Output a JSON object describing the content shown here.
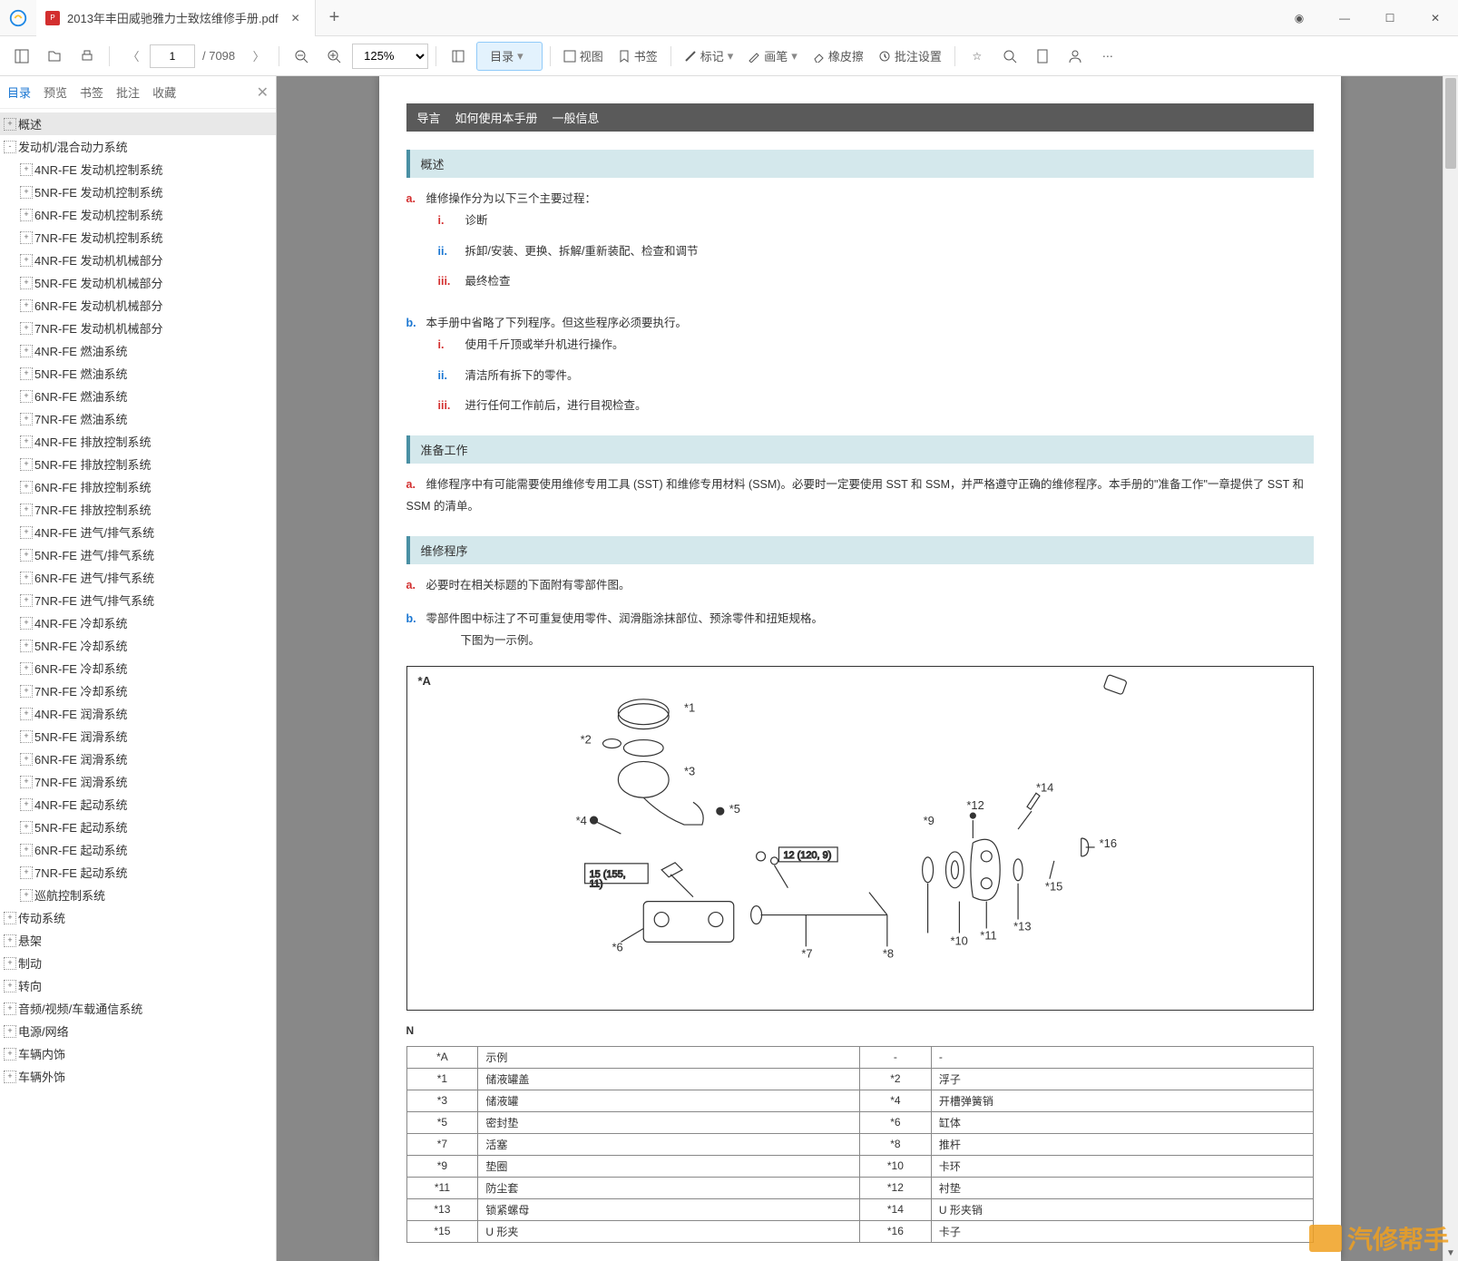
{
  "tab": {
    "title": "2013年丰田威驰雅力士致炫维修手册.pdf",
    "pdf_badge": "P"
  },
  "window": {
    "gear": "⚙"
  },
  "toolbar": {
    "page_current": "1",
    "page_total": "/ 7098",
    "zoom": "125%",
    "toc": "目录",
    "view": "视图",
    "bookmark": "书签",
    "mark": "标记",
    "pen": "画笔",
    "eraser": "橡皮擦",
    "batch": "批注设置"
  },
  "sidebar": {
    "tabs": {
      "toc": "目录",
      "preview": "预览",
      "bookmark": "书签",
      "annot": "批注",
      "fav": "收藏"
    },
    "tree": [
      {
        "lvl": 0,
        "exp": "+",
        "label": "概述",
        "sel": true
      },
      {
        "lvl": 0,
        "exp": "-",
        "label": "发动机/混合动力系统"
      },
      {
        "lvl": 1,
        "exp": "+",
        "label": "4NR-FE 发动机控制系统"
      },
      {
        "lvl": 1,
        "exp": "+",
        "label": "5NR-FE 发动机控制系统"
      },
      {
        "lvl": 1,
        "exp": "+",
        "label": "6NR-FE 发动机控制系统"
      },
      {
        "lvl": 1,
        "exp": "+",
        "label": "7NR-FE 发动机控制系统"
      },
      {
        "lvl": 1,
        "exp": "+",
        "label": "4NR-FE 发动机机械部分"
      },
      {
        "lvl": 1,
        "exp": "+",
        "label": "5NR-FE 发动机机械部分"
      },
      {
        "lvl": 1,
        "exp": "+",
        "label": "6NR-FE 发动机机械部分"
      },
      {
        "lvl": 1,
        "exp": "+",
        "label": "7NR-FE 发动机机械部分"
      },
      {
        "lvl": 1,
        "exp": "+",
        "label": "4NR-FE 燃油系统"
      },
      {
        "lvl": 1,
        "exp": "+",
        "label": "5NR-FE 燃油系统"
      },
      {
        "lvl": 1,
        "exp": "+",
        "label": "6NR-FE 燃油系统"
      },
      {
        "lvl": 1,
        "exp": "+",
        "label": "7NR-FE 燃油系统"
      },
      {
        "lvl": 1,
        "exp": "+",
        "label": "4NR-FE 排放控制系统"
      },
      {
        "lvl": 1,
        "exp": "+",
        "label": "5NR-FE 排放控制系统"
      },
      {
        "lvl": 1,
        "exp": "+",
        "label": "6NR-FE 排放控制系统"
      },
      {
        "lvl": 1,
        "exp": "+",
        "label": "7NR-FE 排放控制系统"
      },
      {
        "lvl": 1,
        "exp": "+",
        "label": "4NR-FE 进气/排气系统"
      },
      {
        "lvl": 1,
        "exp": "+",
        "label": "5NR-FE 进气/排气系统"
      },
      {
        "lvl": 1,
        "exp": "+",
        "label": "6NR-FE 进气/排气系统"
      },
      {
        "lvl": 1,
        "exp": "+",
        "label": "7NR-FE 进气/排气系统"
      },
      {
        "lvl": 1,
        "exp": "+",
        "label": "4NR-FE 冷却系统"
      },
      {
        "lvl": 1,
        "exp": "+",
        "label": "5NR-FE 冷却系统"
      },
      {
        "lvl": 1,
        "exp": "+",
        "label": "6NR-FE 冷却系统"
      },
      {
        "lvl": 1,
        "exp": "+",
        "label": "7NR-FE 冷却系统"
      },
      {
        "lvl": 1,
        "exp": "+",
        "label": "4NR-FE 润滑系统"
      },
      {
        "lvl": 1,
        "exp": "+",
        "label": "5NR-FE 润滑系统"
      },
      {
        "lvl": 1,
        "exp": "+",
        "label": "6NR-FE 润滑系统"
      },
      {
        "lvl": 1,
        "exp": "+",
        "label": "7NR-FE 润滑系统"
      },
      {
        "lvl": 1,
        "exp": "+",
        "label": "4NR-FE 起动系统"
      },
      {
        "lvl": 1,
        "exp": "+",
        "label": "5NR-FE 起动系统"
      },
      {
        "lvl": 1,
        "exp": "+",
        "label": "6NR-FE 起动系统"
      },
      {
        "lvl": 1,
        "exp": "+",
        "label": "7NR-FE 起动系统"
      },
      {
        "lvl": 1,
        "exp": "+",
        "label": "巡航控制系统"
      },
      {
        "lvl": 0,
        "exp": "+",
        "label": "传动系统"
      },
      {
        "lvl": 0,
        "exp": "+",
        "label": "悬架"
      },
      {
        "lvl": 0,
        "exp": "+",
        "label": "制动"
      },
      {
        "lvl": 0,
        "exp": "+",
        "label": "转向"
      },
      {
        "lvl": 0,
        "exp": "+",
        "label": "音频/视频/车载通信系统"
      },
      {
        "lvl": 0,
        "exp": "+",
        "label": "电源/网络"
      },
      {
        "lvl": 0,
        "exp": "+",
        "label": "车辆内饰"
      },
      {
        "lvl": 0,
        "exp": "+",
        "label": "车辆外饰"
      }
    ]
  },
  "doc": {
    "header": [
      "导言",
      "如何使用本手册",
      "一般信息"
    ],
    "sec1": {
      "title": "概述",
      "a": "维修操作分为以下三个主要过程：",
      "a_i": "诊断",
      "a_ii": "拆卸/安装、更换、拆解/重新装配、检查和调节",
      "a_iii": "最终检查",
      "b": "本手册中省略了下列程序。但这些程序必须要执行。",
      "b_i": "使用千斤顶或举升机进行操作。",
      "b_ii": "清洁所有拆下的零件。",
      "b_iii": "进行任何工作前后，进行目视检查。"
    },
    "sec2": {
      "title": "准备工作",
      "a": "维修程序中有可能需要使用维修专用工具 (SST) 和维修专用材料 (SSM)。必要时一定要使用 SST 和 SSM，并严格遵守正确的维修程序。本手册的\"准备工作\"一章提供了 SST 和 SSM 的清单。"
    },
    "sec3": {
      "title": "维修程序",
      "a": "必要时在相关标题的下面附有零部件图。",
      "b": "零部件图中标注了不可重复使用零件、润滑脂涂抹部位、预涂零件和扭矩规格。",
      "b_sub": "下图为一示例。"
    },
    "diagram": {
      "corner": "*A",
      "labels": [
        "*1",
        "*2",
        "*3",
        "*4",
        "*5",
        "*6",
        "*7",
        "*8",
        "*9",
        "*10",
        "*11",
        "*12",
        "*13",
        "*14",
        "*15",
        "*16"
      ],
      "box1": "15 (155, 11)",
      "box2": "12 (120, 9)"
    },
    "n_label": "N",
    "parts": [
      [
        "*A",
        "示例",
        "-",
        "-"
      ],
      [
        "*1",
        "储液罐盖",
        "*2",
        "浮子"
      ],
      [
        "*3",
        "储液罐",
        "*4",
        "开槽弹簧销"
      ],
      [
        "*5",
        "密封垫",
        "*6",
        "缸体"
      ],
      [
        "*7",
        "活塞",
        "*8",
        "推杆"
      ],
      [
        "*9",
        "垫圈",
        "*10",
        "卡环"
      ],
      [
        "*11",
        "防尘套",
        "*12",
        "衬垫"
      ],
      [
        "*13",
        "锁紧螺母",
        "*14",
        "U 形夹销"
      ],
      [
        "*15",
        "U 形夹",
        "*16",
        "卡子"
      ]
    ]
  },
  "watermark": "汽修帮手"
}
